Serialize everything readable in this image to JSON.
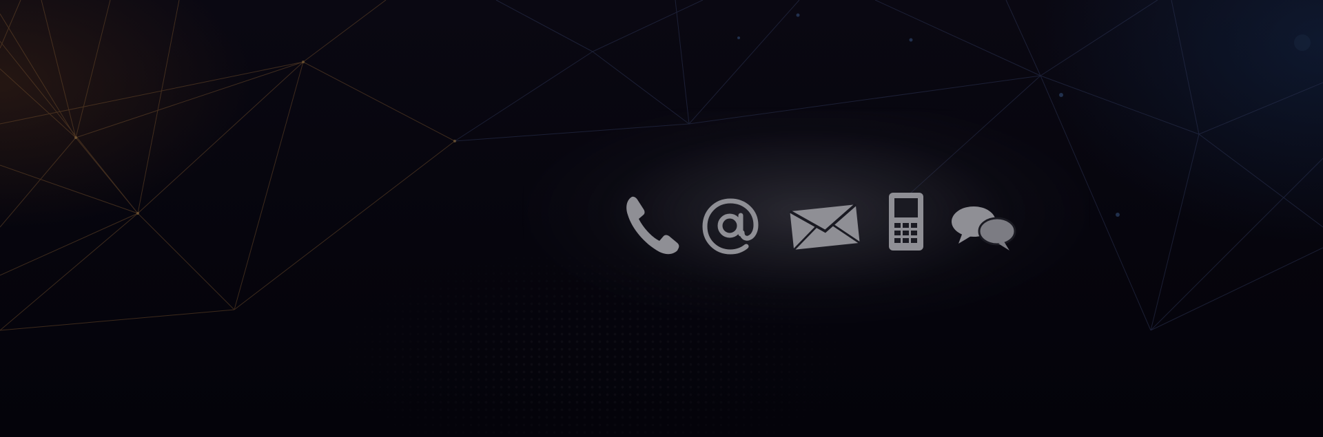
{
  "banner": {
    "icons": [
      {
        "name": "phone-icon"
      },
      {
        "name": "at-sign-icon",
        "glyph": "@"
      },
      {
        "name": "envelope-icon"
      },
      {
        "name": "mobile-phone-icon"
      },
      {
        "name": "chat-bubbles-icon"
      }
    ],
    "colors": {
      "background": "#05040c",
      "warm_lines": "#6b4a2a",
      "cool_lines": "#22304f",
      "icon_fill": "#8f8f95"
    }
  }
}
